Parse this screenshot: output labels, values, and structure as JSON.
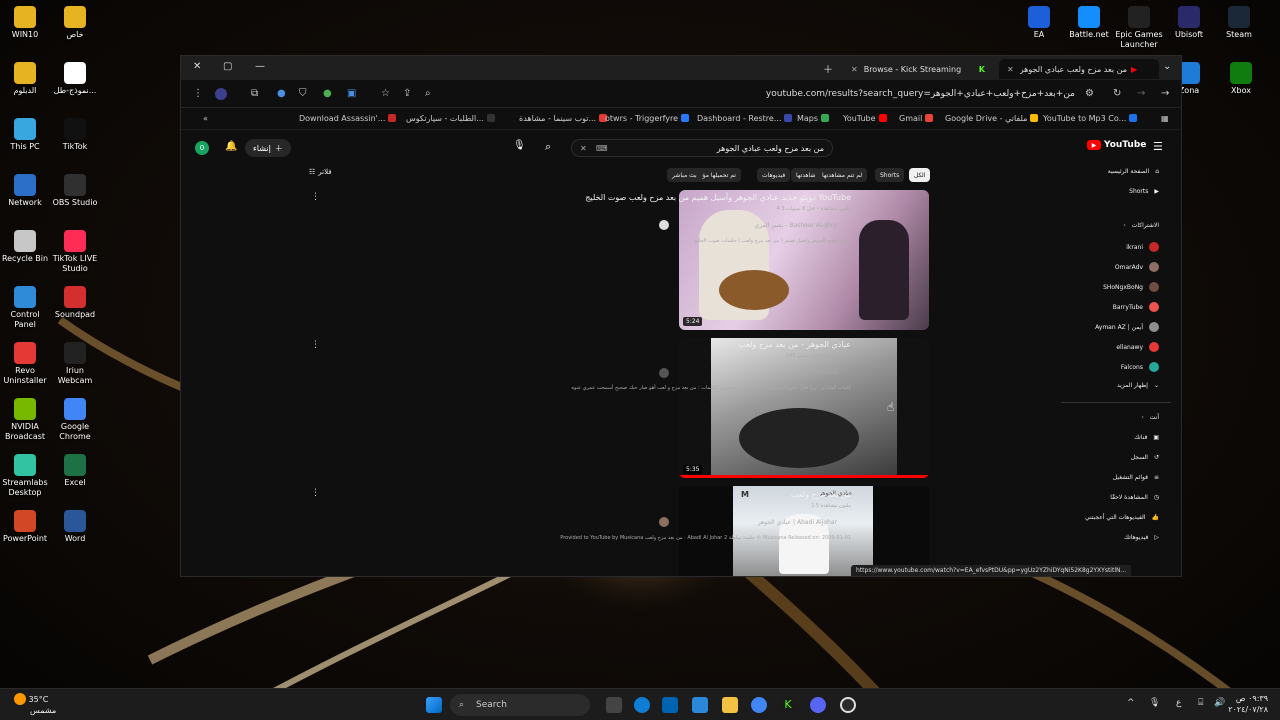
{
  "desktop_left": [
    {
      "label": "WIN10",
      "icon": "folder-icon",
      "color": "#e6b422"
    },
    {
      "label": "خاص",
      "icon": "folder-icon",
      "color": "#e6b422"
    },
    {
      "label": "الدبلوم",
      "icon": "folder-icon",
      "color": "#e6b422"
    },
    {
      "label": "نموذج-طل...",
      "icon": "chrome-doc-icon",
      "color": "#ffffff"
    },
    {
      "label": "This PC",
      "icon": "monitor-icon",
      "color": "#38a7e0"
    },
    {
      "label": "TikTok",
      "icon": "tiktok-icon",
      "color": "#111111"
    },
    {
      "label": "Network",
      "icon": "network-icon",
      "color": "#2c6fc9"
    },
    {
      "label": "OBS Studio",
      "icon": "obs-icon",
      "color": "#303030"
    },
    {
      "label": "Recycle Bin",
      "icon": "recycle-bin-icon",
      "color": "#c7c7c7"
    },
    {
      "label": "TikTok LIVE Studio",
      "icon": "tiktok-live-icon",
      "color": "#ff2d55"
    },
    {
      "label": "Control Panel",
      "icon": "control-panel-icon",
      "color": "#2f8ad8"
    },
    {
      "label": "Soundpad",
      "icon": "soundpad-icon",
      "color": "#d32f2f"
    },
    {
      "label": "Revo Uninstaller",
      "icon": "revo-icon",
      "color": "#e53935"
    },
    {
      "label": "Iriun Webcam",
      "icon": "webcam-icon",
      "color": "#222222"
    },
    {
      "label": "NVIDIA Broadcast",
      "icon": "nvidia-icon",
      "color": "#76b900"
    },
    {
      "label": "Google Chrome",
      "icon": "chrome-icon",
      "color": "#4285f4"
    },
    {
      "label": "Streamlabs Desktop",
      "icon": "streamlabs-icon",
      "color": "#31c3a2"
    },
    {
      "label": "Excel",
      "icon": "excel-icon",
      "color": "#1e7145"
    },
    {
      "label": "PowerPoint",
      "icon": "powerpoint-icon",
      "color": "#d24726"
    },
    {
      "label": "Word",
      "icon": "word-icon",
      "color": "#2b579a"
    }
  ],
  "desktop_right": [
    {
      "label": "EA",
      "icon": "ea-icon",
      "color": "#1c5fd8"
    },
    {
      "label": "Battle.net",
      "icon": "battlenet-icon",
      "color": "#148eff"
    },
    {
      "label": "Epic Games Launcher",
      "icon": "epic-icon",
      "color": "#222222"
    },
    {
      "label": "Ubisoft",
      "icon": "ubisoft-icon",
      "color": "#2a2a6a"
    },
    {
      "label": "Steam",
      "icon": "steam-icon",
      "color": "#1b2838"
    },
    {
      "label": "Zona",
      "icon": "zona-icon",
      "color": "#1f7bd8"
    },
    {
      "label": "Xbox",
      "icon": "xbox-icon",
      "color": "#107c10"
    }
  ],
  "browser": {
    "tabs": [
      {
        "label": "Browse - Kick Streaming"
      },
      {
        "label": "من بعد مزح ولعب عبادي الجوهر"
      }
    ],
    "url": "youtube.com/results?search_query=من+بعد+مزح+ولعب+عبادي+الجوهر",
    "bookmarks": [
      {
        "label": "Download Assassin'...",
        "color": "#c62828"
      },
      {
        "label": "الطلبات - سيارتكوس...",
        "color": "#333333"
      },
      {
        "label": "توب سينما - مشاهدة...",
        "color": "#e53935"
      },
      {
        "label": "otwrs - Triggerfyre",
        "color": "#2979ff"
      },
      {
        "label": "Dashboard - Restre...",
        "color": "#3949ab"
      },
      {
        "label": "Maps",
        "color": "#34a853"
      },
      {
        "label": "YouTube",
        "color": "#ff0000"
      },
      {
        "label": "Gmail",
        "color": "#ea4335"
      },
      {
        "label": "Google Drive - ملفاتي",
        "color": "#fbbc04"
      },
      {
        "label": "YouTube to Mp3 Co...",
        "color": "#1a73e8"
      }
    ]
  },
  "youtube": {
    "search_value": "من بعد مزح ولعب عبادي الجوهر",
    "create_label": "إنشاء",
    "notif_badge": "0",
    "filter_label": "فلاتر",
    "logo": "YouTube",
    "chips": [
      "الكل",
      "Shorts",
      "لم تتم مشاهدتها",
      "شاهدتها",
      "فيديوهات",
      "تم تحميلها مؤخرًا",
      "بث مباشر"
    ],
    "results": [
      {
        "title": "دويتو جديد عبادي الجوهر وأسيل هميم من بعد مزح ولعب صوت الخليج YouTube",
        "meta": "4.3 مليون مشاهدة • قبل 8 سنوات",
        "channel": "بشير المري - Basheer ALgbry",
        "desc": "دويتو عبادي الجوهر واصيل هميم ( من بعد مزح ولعب ) جلسات صوت الخليج",
        "duration": "5:24"
      },
      {
        "title": "عبادي الجوهر - من بعد مزح ولعب",
        "meta": "647 ألف مشاهدة • قبل سنتين",
        "channel": "أرشيف - Archive",
        "desc": "كلمات الشاعر : ثريا قابل لحن الموسيقار الكبير : فوزي محسون الكلمات : من بعد مزح و لعب أهو صار حبك صحيح أسمحت عمري عنوه",
        "duration": "5:35"
      },
      {
        "title": "من بعد مزح ولعب",
        "meta": "1.5 مليون مشاهدة",
        "channel": "عبادي الجوهر | Abadi Aljohar",
        "desc": "Provided to YouTube by Musicana من بعد مزح ولعب · Abadi Al Johar 2 جلسة سلطة ℗ Musicana Released on: 2009-01-01",
        "duration": ""
      }
    ],
    "thumb3_caption": "عبادي الجوهر",
    "sidebar_main": [
      {
        "label": "الصفحة الرئيسية",
        "icon": "home-icon"
      },
      {
        "label": "Shorts",
        "icon": "shorts-icon"
      }
    ],
    "subs_header": "الاشتراكات",
    "subscriptions": [
      {
        "label": "ikrani",
        "color": "#c62828"
      },
      {
        "label": "OmarAdv",
        "color": "#8d6e63"
      },
      {
        "label": "SHoNgxBoNg",
        "color": "#6d4c41"
      },
      {
        "label": "BarryTube",
        "color": "#ef5350"
      },
      {
        "label": "Ayman AZ | أيمن",
        "color": "#8e8e8e"
      },
      {
        "label": "ellanawy",
        "color": "#e53935"
      },
      {
        "label": "Falcons",
        "color": "#26a69a"
      },
      {
        "label": "إظهار المزيد",
        "color": ""
      }
    ],
    "you_header": "أنت",
    "you_items": [
      {
        "label": "قناتك",
        "icon": "channel-icon"
      },
      {
        "label": "السجل",
        "icon": "history-icon"
      },
      {
        "label": "قوائم التشغيل",
        "icon": "playlist-icon"
      },
      {
        "label": "المشاهدة لاحقًا",
        "icon": "clock-icon"
      },
      {
        "label": "الفيديوهات التي أعجبتني",
        "icon": "like-icon"
      },
      {
        "label": "فيديوهاتك",
        "icon": "video-icon"
      }
    ],
    "hover_url": "https://www.youtube.com/watch?v=EA_efvsPtDU&pp=ygUz2YZhiDYqNi52K8g2YXYstitlN..."
  },
  "taskbar": {
    "weather_temp": "35°C",
    "weather_desc": "مشمس",
    "search_label": "Search",
    "time": "٠٩:٣٩ ص",
    "date": "٢٠٢٤/٠٧/٢٨",
    "lang": "ع"
  },
  "colors": {
    "yt_red": "#ff0000",
    "accent": "#3ea6ff"
  }
}
